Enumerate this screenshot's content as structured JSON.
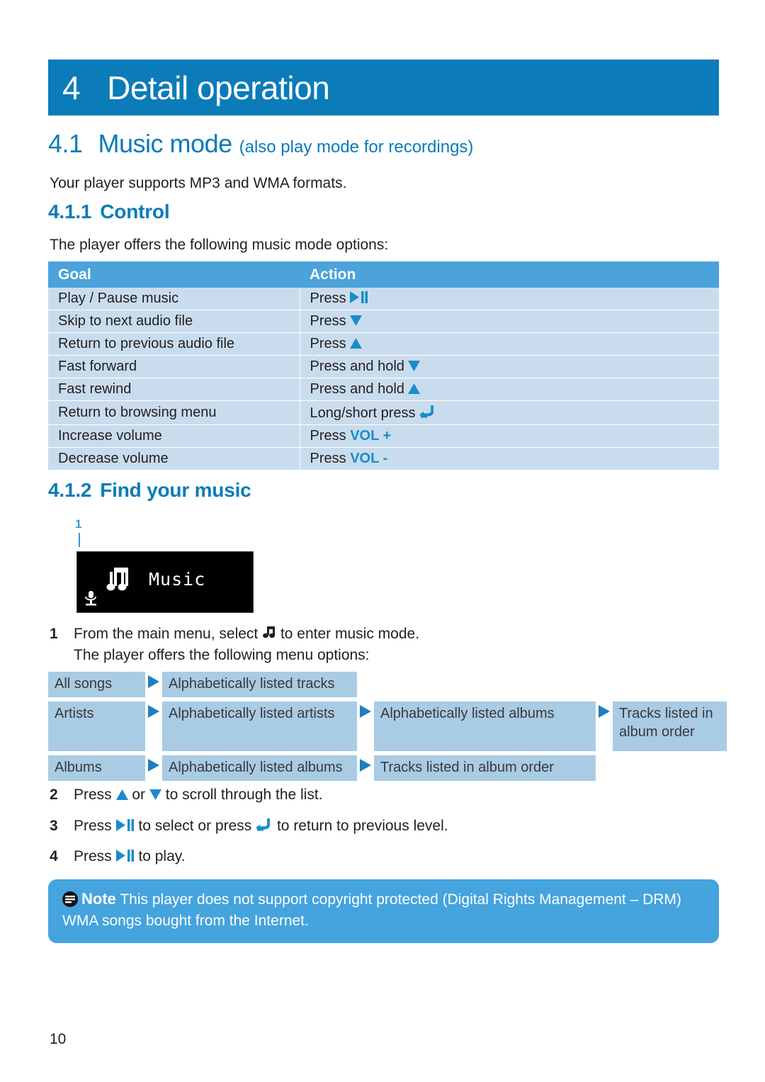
{
  "chapter": {
    "number": "4",
    "title": "Detail operation"
  },
  "section": {
    "number": "4.1",
    "title": "Music mode",
    "subtitle": "(also play mode for recordings)",
    "intro": "Your player supports MP3 and WMA formats."
  },
  "control": {
    "heading_number": "4.1.1",
    "heading_title": "Control",
    "intro": "The player offers the following music mode options:",
    "columns": [
      "Goal",
      "Action"
    ],
    "rows": [
      {
        "goal": "Play / Pause music",
        "action_pre": "Press",
        "icon": "play-pause-icon",
        "action_post": ""
      },
      {
        "goal": "Skip to next audio file",
        "action_pre": "Press",
        "icon": "triangle-down-icon",
        "action_post": ""
      },
      {
        "goal": "Return to previous audio file",
        "action_pre": "Press",
        "icon": "triangle-up-icon",
        "action_post": ""
      },
      {
        "goal": "Fast forward",
        "action_pre": "Press and hold",
        "icon": "triangle-down-icon",
        "action_post": ""
      },
      {
        "goal": "Fast rewind",
        "action_pre": "Press and hold",
        "icon": "triangle-up-icon",
        "action_post": ""
      },
      {
        "goal": "Return to browsing menu",
        "action_pre": "Long/short press",
        "icon": "back-arrow-icon",
        "action_post": ""
      },
      {
        "goal": "Increase volume",
        "action_pre": "Press",
        "icon": "vol-plus-label",
        "action_post": "VOL +"
      },
      {
        "goal": "Decrease volume",
        "action_pre": "Press",
        "icon": "vol-minus-label",
        "action_post": "VOL -"
      }
    ]
  },
  "find": {
    "heading_number": "4.1.2",
    "heading_title": "Find your music",
    "callout_number": "1",
    "lcd": {
      "label": "Music",
      "note_icon": "music-note-icon",
      "record_icon": "microphone-icon"
    },
    "steps": [
      {
        "n": "1",
        "text_before": "From the main menu, select",
        "icon": "music-note-icon",
        "text_after": "to enter music mode.",
        "line2": "The player offers the following menu options:"
      },
      {
        "n": "2",
        "text_before": "Press",
        "icon": "triangle-up-icon",
        "text_mid": "or",
        "icon2": "triangle-down-icon",
        "text_after": "to scroll through the list."
      },
      {
        "n": "3",
        "text_before": "Press",
        "icon": "play-pause-icon",
        "text_mid": "to select or press",
        "icon2": "back-arrow-icon",
        "text_after": "to return to previous level."
      },
      {
        "n": "4",
        "text_before": "Press",
        "icon": "play-pause-icon",
        "text_after": "to play."
      }
    ],
    "menu_diagram": [
      {
        "level1": "All songs",
        "level2": "Alphabetically listed tracks",
        "level3": "",
        "level4": ""
      },
      {
        "level1": "Artists",
        "level2": "Alphabetically listed artists",
        "level3": "Alphabetically listed albums",
        "level4": "Tracks listed in album order"
      },
      {
        "level1": "Albums",
        "level2": "Alphabetically listed albums",
        "level3": "Tracks listed in album order",
        "level4": ""
      }
    ]
  },
  "note": {
    "icon": "note-lines-icon",
    "label": "Note",
    "text": "This player does not support copyright protected (Digital Rights Management – DRM) WMA songs bought from the Internet."
  },
  "footer": {
    "page_number": "10"
  },
  "colors": {
    "brand_blue": "#0b7bb9",
    "table_header_blue": "#4aa3db",
    "table_row_blue": "#c9dced",
    "diagram_box_blue": "#a9cbe4",
    "note_box_blue": "#45a3dd",
    "icon_blue": "#1a8ccc"
  }
}
